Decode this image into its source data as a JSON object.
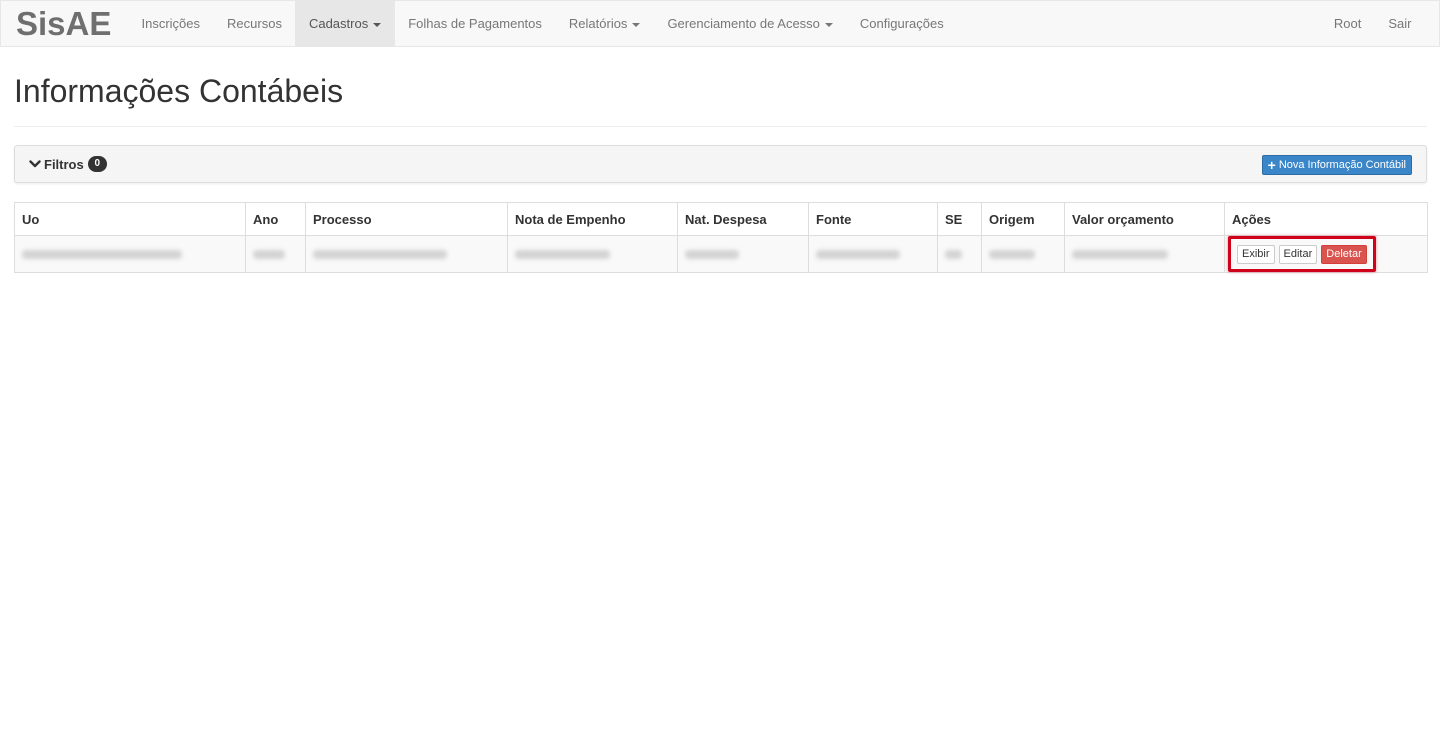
{
  "app": {
    "brand": "SisAE"
  },
  "nav": {
    "items": [
      {
        "label": "Inscrições",
        "dropdown": false,
        "active": false
      },
      {
        "label": "Recursos",
        "dropdown": false,
        "active": false
      },
      {
        "label": "Cadastros",
        "dropdown": true,
        "active": true
      },
      {
        "label": "Folhas de Pagamentos",
        "dropdown": false,
        "active": false
      },
      {
        "label": "Relatórios",
        "dropdown": true,
        "active": false
      },
      {
        "label": "Gerenciamento de Acesso",
        "dropdown": true,
        "active": false
      },
      {
        "label": "Configurações",
        "dropdown": false,
        "active": false
      }
    ],
    "right": [
      {
        "label": "Root"
      },
      {
        "label": "Sair"
      }
    ]
  },
  "page": {
    "title": "Informações Contábeis"
  },
  "filters": {
    "label": "Filtros",
    "count": "0",
    "icon": "chevron-down-icon",
    "new_button_icon": "plus-icon",
    "new_button": "Nova Informação Contábil"
  },
  "table": {
    "headers": [
      "Uo",
      "Ano",
      "Processo",
      "Nota de Empenho",
      "Nat. Despesa",
      "Fonte",
      "SE",
      "Origem",
      "Valor orçamento",
      "Ações"
    ],
    "rows": [
      {
        "cells": [
          "",
          "",
          "",
          "",
          "",
          "",
          "",
          "",
          ""
        ],
        "redacted": true,
        "actions": {
          "view": "Exibir",
          "edit": "Editar",
          "delete": "Deletar"
        }
      }
    ]
  },
  "colors": {
    "highlight": "#d0021b",
    "primary": "#3a86c8",
    "danger": "#d9534f",
    "navbar_bg": "#f8f8f8"
  }
}
